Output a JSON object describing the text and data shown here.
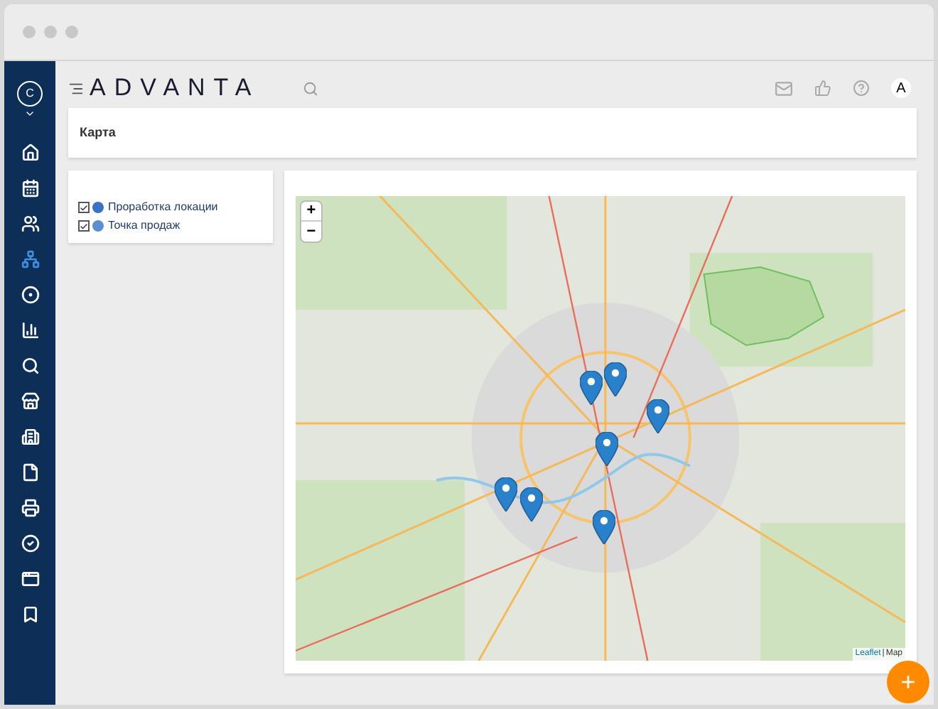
{
  "sidebar": {
    "avatar": "C",
    "items": [
      {
        "selected": false
      },
      {
        "selected": false
      },
      {
        "selected": false
      },
      {
        "selected": true
      },
      {
        "selected": false
      },
      {
        "selected": false
      },
      {
        "selected": false
      },
      {
        "selected": false
      },
      {
        "selected": false
      },
      {
        "selected": false
      },
      {
        "selected": false
      },
      {
        "selected": false
      },
      {
        "selected": false
      },
      {
        "selected": false
      }
    ]
  },
  "header": {
    "logo": "ADVANTA",
    "user_avatar": "A"
  },
  "page_title": "Карта",
  "layers": [
    {
      "label": "Проработка локации",
      "checked": true
    },
    {
      "label": "Точка продаж",
      "checked": true
    }
  ],
  "map": {
    "zoom_in": "+",
    "zoom_out": "−",
    "attribution_link": "Leaflet",
    "attribution_separator": "|",
    "attribution_text": "Map"
  },
  "fab": "+"
}
